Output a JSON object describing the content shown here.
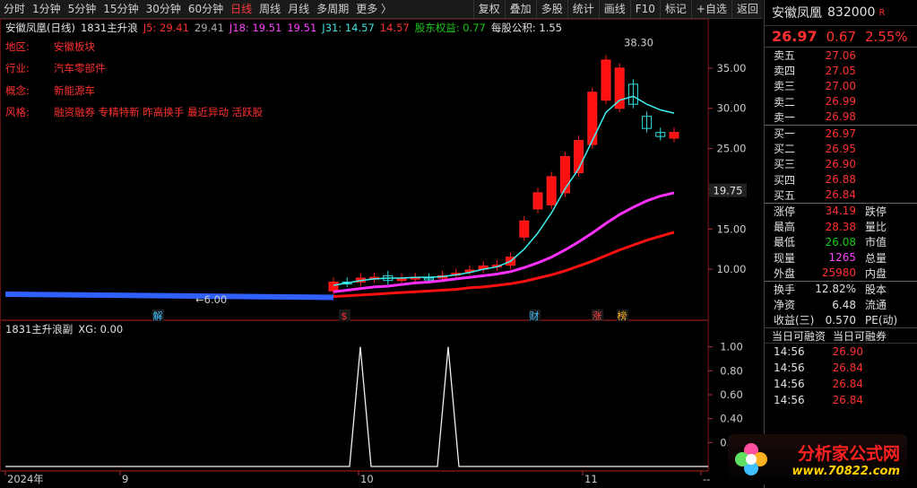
{
  "toolbar": {
    "periods": [
      "分时",
      "1分钟",
      "5分钟",
      "15分钟",
      "30分钟",
      "60分钟",
      "日线",
      "周线",
      "月线",
      "多周期",
      "更多 〉"
    ],
    "active_period": "日线",
    "tools": [
      "复权",
      "叠加",
      "多股",
      "统计",
      "画线",
      "F10",
      "标记",
      "+自选",
      "返回"
    ]
  },
  "main_header": {
    "stock": "安徽凤凰(日线)",
    "indicator": "1831主升浪",
    "j5": "J5: 29.41",
    "j5b": "29.41",
    "j18": "J18: 19.51",
    "j18b": "19.51",
    "j31": "J31: 14.57",
    "j31b": "14.57",
    "equity": "股东权益: 0.77",
    "fund": "每股公积: 1.55"
  },
  "info": [
    {
      "k": "地区:",
      "v": "安徽板块"
    },
    {
      "k": "行业:",
      "v": "汽车零部件"
    },
    {
      "k": "概念:",
      "v": "新能源车"
    },
    {
      "k": "风格:",
      "v": "融资融券 专精特新 昨高换手 最近异动 活跃股"
    }
  ],
  "sub_header": {
    "indicator": "1831主升浪副",
    "xg": "XG: 0.00"
  },
  "chart_labels": {
    "high": "38.30",
    "low": "6.00",
    "last": "19.75",
    "markers": [
      "解",
      "$",
      "财",
      "涨",
      "榜"
    ],
    "years": [
      "2024年",
      "9",
      "10",
      "11",
      "--"
    ]
  },
  "chart_data": [
    {
      "type": "line",
      "title": "",
      "ylim": [
        5,
        39
      ],
      "yticks": [
        10.0,
        15.0,
        20.0,
        25.0,
        30.0,
        35.0
      ],
      "candles": [
        {
          "o": 7.3,
          "c": 8.4
        },
        {
          "o": 8.4,
          "c": 8.3
        },
        {
          "o": 8.4,
          "c": 8.9
        },
        {
          "o": 8.8,
          "c": 9.0
        },
        {
          "o": 9.2,
          "c": 8.6
        },
        {
          "o": 8.6,
          "c": 8.9
        },
        {
          "o": 8.9,
          "c": 9.0
        },
        {
          "o": 8.9,
          "c": 8.8
        },
        {
          "o": 8.9,
          "c": 9.2
        },
        {
          "o": 9.3,
          "c": 9.5
        },
        {
          "o": 9.8,
          "c": 9.9
        },
        {
          "o": 10.0,
          "c": 10.4
        },
        {
          "o": 10.3,
          "c": 10.5
        },
        {
          "o": 10.5,
          "c": 11.5
        },
        {
          "o": 14.0,
          "c": 16.0
        },
        {
          "o": 17.5,
          "c": 19.5
        },
        {
          "o": 18.0,
          "c": 21.5
        },
        {
          "o": 19.5,
          "c": 24.0
        },
        {
          "o": 22.0,
          "c": 26.0
        },
        {
          "o": 25.5,
          "c": 32.0
        },
        {
          "o": 31.0,
          "c": 36.0
        },
        {
          "o": 30.0,
          "c": 35.0
        },
        {
          "o": 33.0,
          "c": 30.5
        },
        {
          "o": 29.0,
          "c": 27.5
        },
        {
          "o": 27.0,
          "c": 26.5
        },
        {
          "o": 26.3,
          "c": 27.0
        }
      ],
      "series": [
        {
          "name": "J5",
          "values": [
            8,
            8.3,
            8.6,
            8.8,
            8.9,
            8.9,
            9,
            9,
            9.1,
            9.3,
            9.6,
            10,
            10.3,
            11,
            12.5,
            14.5,
            17,
            20,
            22.5,
            26,
            29.5,
            31,
            31.5,
            30.5,
            29.8,
            29.4
          ]
        },
        {
          "name": "J18",
          "values": [
            7.2,
            7.4,
            7.6,
            7.8,
            7.9,
            8.1,
            8.3,
            8.4,
            8.6,
            8.8,
            9,
            9.2,
            9.4,
            9.7,
            10.2,
            10.8,
            11.5,
            12.4,
            13.4,
            14.5,
            15.7,
            16.8,
            17.7,
            18.5,
            19.1,
            19.5
          ]
        },
        {
          "name": "J31",
          "values": [
            6.6,
            6.7,
            6.8,
            6.9,
            7,
            7.1,
            7.2,
            7.3,
            7.4,
            7.5,
            7.7,
            7.8,
            8,
            8.2,
            8.5,
            8.9,
            9.3,
            9.8,
            10.4,
            11,
            11.7,
            12.4,
            13,
            13.6,
            14.1,
            14.6
          ]
        }
      ]
    },
    {
      "type": "line",
      "title": "",
      "ylim": [
        0,
        1.05
      ],
      "yticks": [
        0.2,
        0.4,
        0.6,
        0.8,
        1.0
      ],
      "series": [
        {
          "name": "XG",
          "values": [
            0,
            0,
            1,
            0,
            0,
            0,
            1,
            0,
            0,
            0,
            0,
            0
          ]
        }
      ]
    }
  ],
  "panel": {
    "name": "安徽凤凰",
    "code": "832000",
    "tag": "R",
    "price": "26.97",
    "change": "0.67",
    "pct": "2.55%",
    "asks": [
      {
        "l": "卖五",
        "p": "27.06"
      },
      {
        "l": "卖四",
        "p": "27.05"
      },
      {
        "l": "卖三",
        "p": "27.00"
      },
      {
        "l": "卖二",
        "p": "26.99"
      },
      {
        "l": "卖一",
        "p": "26.98"
      }
    ],
    "bids": [
      {
        "l": "买一",
        "p": "26.97"
      },
      {
        "l": "买二",
        "p": "26.95"
      },
      {
        "l": "买三",
        "p": "26.90"
      },
      {
        "l": "买四",
        "p": "26.88"
      },
      {
        "l": "买五",
        "p": "26.84"
      }
    ],
    "stats": [
      {
        "l": "涨停",
        "v": "34.19",
        "c": "red",
        "l2": "跌停"
      },
      {
        "l": "最高",
        "v": "28.38",
        "c": "red",
        "l2": "量比"
      },
      {
        "l": "最低",
        "v": "26.08",
        "c": "green",
        "l2": "市值"
      },
      {
        "l": "现量",
        "v": "1265",
        "c": "magenta",
        "l2": "总量"
      },
      {
        "l": "外盘",
        "v": "25980",
        "c": "red",
        "l2": "内盘"
      }
    ],
    "stats2": [
      {
        "l": "换手",
        "v": "12.82%",
        "l2": "股本"
      },
      {
        "l": "净资",
        "v": "6.48",
        "l2": "流通"
      },
      {
        "l": "收益(三)",
        "v": "0.570",
        "l2": "PE(动)"
      }
    ],
    "margin_head": [
      "当日可融资",
      "当日可融券"
    ],
    "trades": [
      {
        "t": "14:56",
        "p": "26.90"
      },
      {
        "t": "14:56",
        "p": "26.84"
      },
      {
        "t": "14:56",
        "p": "26.84"
      },
      {
        "t": "14:56",
        "p": "26.84"
      }
    ]
  },
  "watermark": {
    "line1": "分析家公式网",
    "line2": "www.70822.com"
  }
}
